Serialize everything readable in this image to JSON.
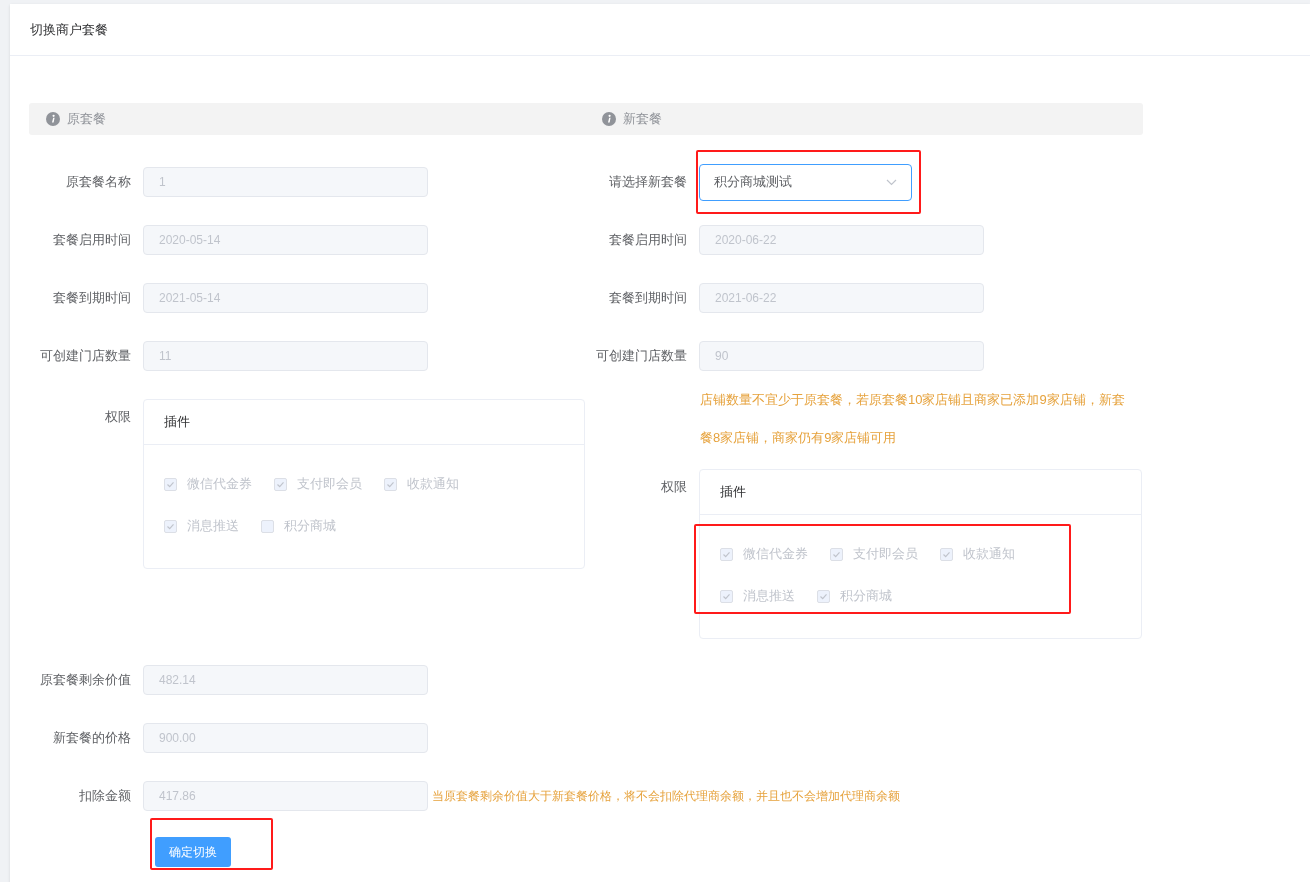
{
  "title": "切换商户套餐",
  "original": {
    "heading": "原套餐",
    "fields": [
      {
        "label": "原套餐名称",
        "value": "1"
      },
      {
        "label": "套餐启用时间",
        "value": "2020-05-14"
      },
      {
        "label": "套餐到期时间",
        "value": "2021-05-14"
      },
      {
        "label": "可创建门店数量",
        "value": "11"
      }
    ],
    "permissions": {
      "label": "权限",
      "card_title": "插件",
      "plugins": [
        {
          "label": "微信代金券",
          "checked": true
        },
        {
          "label": "支付即会员",
          "checked": true
        },
        {
          "label": "收款通知",
          "checked": true
        },
        {
          "label": "消息推送",
          "checked": true
        },
        {
          "label": "积分商城",
          "checked": false
        }
      ]
    }
  },
  "new": {
    "heading": "新套餐",
    "select": {
      "label": "请选择新套餐",
      "value": "积分商城测试",
      "highlighted": true
    },
    "fields": [
      {
        "label": "套餐启用时间",
        "value": "2020-06-22"
      },
      {
        "label": "套餐到期时间",
        "value": "2021-06-22"
      },
      {
        "label": "可创建门店数量",
        "value": "90"
      }
    ],
    "hint": "店铺数量不宜少于原套餐，若原套餐10家店铺且商家已添加9家店铺，新套餐8家店铺，商家仍有9家店铺可用",
    "permissions": {
      "label": "权限",
      "card_title": "插件",
      "highlighted": true,
      "plugins": [
        {
          "label": "微信代金券",
          "checked": true
        },
        {
          "label": "支付即会员",
          "checked": true
        },
        {
          "label": "收款通知",
          "checked": true
        },
        {
          "label": "消息推送",
          "checked": true
        },
        {
          "label": "积分商城",
          "checked": true
        }
      ]
    }
  },
  "totals": [
    {
      "label": "原套餐剩余价值",
      "value": "482.14"
    },
    {
      "label": "新套餐的价格",
      "value": "900.00"
    },
    {
      "label": "扣除金额",
      "value": "417.86",
      "hint": "当原套餐剩余价值大于新套餐价格，将不会扣除代理商余额，并且也不会增加代理商余额"
    }
  ],
  "submit": {
    "label": "确定切换",
    "highlighted": true
  }
}
